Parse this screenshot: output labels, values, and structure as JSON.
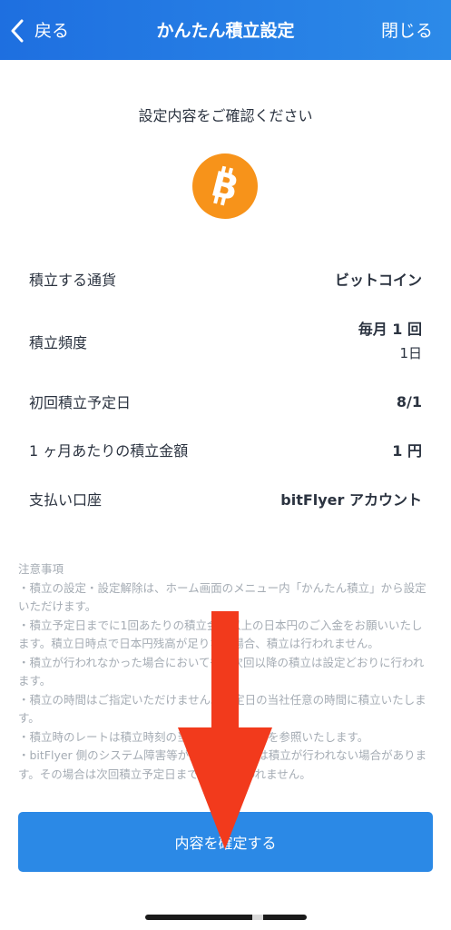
{
  "header": {
    "back_label": "戻る",
    "title": "かんたん積立設定",
    "close_label": "閉じる"
  },
  "subtitle": "設定内容をご確認ください",
  "coin_icon": "bitcoin-icon",
  "colors": {
    "header_start": "#1e6fe0",
    "header_end": "#2c8ae8",
    "coin": "#f7931a",
    "button": "#2b89e6",
    "arrow": "#f23a1c"
  },
  "details": {
    "currency": {
      "label": "積立する通貨",
      "value": "ビットコイン"
    },
    "frequency": {
      "label": "積立頻度",
      "value": "毎月 1 回",
      "sub_value": "1日"
    },
    "first_date": {
      "label": "初回積立予定日",
      "value": "8/1"
    },
    "monthly_amount": {
      "label": "1 ヶ月あたりの積立金額",
      "value": "1 円"
    },
    "payment_account": {
      "label": "支払い口座",
      "value": "bitFlyer アカウント"
    }
  },
  "notes": {
    "heading": "注意事項",
    "items": [
      "・積立の設定・設定解除は、ホーム画面のメニュー内「かんたん積立」から設定いただけます。",
      "・積立予定日までに1回あたりの積立金額以上の日本円のご入金をお願いいたします。積立日時点で日本円残高が足りない場合、積立は行われません。",
      "・積立が行われなかった場合においても、次回以降の積立は設定どおりに行われます。",
      "・積立の時間はご指定いただけません。指定日の当社任意の時間に積立いたします。",
      "・積立時のレートは積立時刻の当社取引所の価格を参照いたします。",
      "・bitFlyer 側のシステム障害等が発生した場合は積立が行われない場合があります。その場合は次回積立予定日まで積立は行われません。"
    ]
  },
  "confirm_button": "内容を確定する"
}
